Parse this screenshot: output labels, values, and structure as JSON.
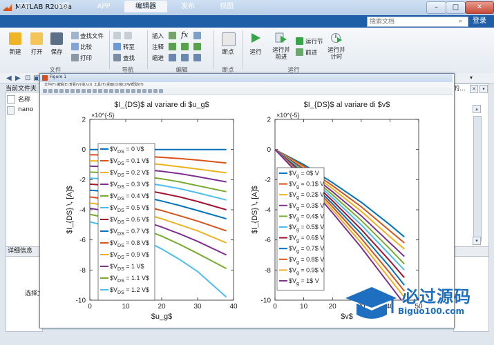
{
  "window": {
    "title": "MATLAB R2018a"
  },
  "tabs": [
    {
      "label": "主页",
      "active": false
    },
    {
      "label": "绘图",
      "active": false
    },
    {
      "label": "APP",
      "active": false
    },
    {
      "label": "编辑器",
      "active": true
    },
    {
      "label": "发布",
      "active": false
    },
    {
      "label": "视图",
      "active": false
    }
  ],
  "search": {
    "placeholder": "搜索文档"
  },
  "login_label": "登录",
  "ribbon": {
    "file": {
      "new": "新建",
      "open": "打开",
      "save": "保存",
      "find_files": "查找文件",
      "compare": "比较",
      "print": "打印",
      "group": "文件"
    },
    "navigate": {
      "goto": "转至",
      "find": "查找",
      "group": "导航"
    },
    "edit": {
      "insert": "插入",
      "comment": "注释",
      "indent": "缩进",
      "group": "编辑"
    },
    "breakpoints": {
      "bp": "断点",
      "group": "断点"
    },
    "run": {
      "run": "运行",
      "run_advance": "运行并\n前进",
      "run_section": "运行节",
      "advance": "前进",
      "run_time": "运行并\n计时",
      "group": "运行"
    }
  },
  "left_panel": {
    "header": "当前文件夹",
    "name_col": "名称",
    "file": "nano",
    "detail_header": "详细信息",
    "select_hint": "选择文"
  },
  "right_panel": {
    "header": "的..."
  },
  "figure": {
    "title": "Figure 1",
    "menu": [
      "文件(F)",
      "编辑(E)",
      "查看(V)",
      "插入(I)",
      "工具(T)",
      "桌面(D)",
      "窗口(W)",
      "帮助(H)"
    ]
  },
  "watermark": {
    "text": "必过源码",
    "url": "Biguo100.com"
  },
  "colors": {
    "series": [
      "#0072BD",
      "#D95319",
      "#EDB120",
      "#7E2F8E",
      "#77AC30",
      "#4DBEEE",
      "#A2142F"
    ]
  },
  "chart_data": [
    {
      "type": "line",
      "title": "$I_{DS}$ al variare di $u_g$",
      "xlabel": "$u_g$",
      "ylabel": "$I_{DS} \\, [A]$",
      "exponent_label": "×10^{-5}",
      "xlim": [
        0,
        40
      ],
      "ylim": [
        -10,
        2
      ],
      "xticks": [
        0,
        10,
        20,
        30,
        40
      ],
      "yticks": [
        2,
        0,
        -2,
        -4,
        -6,
        -8,
        -10
      ],
      "grid": false,
      "legend_position": "left-center",
      "legend_subscript": "DS",
      "series": [
        {
          "name": "$V_{DS} = 0 V$",
          "x": [
            0,
            5,
            10,
            15,
            20,
            25,
            30,
            38
          ],
          "y": [
            0,
            0,
            0,
            0,
            0,
            0,
            0,
            0
          ]
        },
        {
          "name": "$V_{DS} = 0.1 V$",
          "x": [
            0,
            5,
            10,
            15,
            20,
            25,
            30,
            38
          ],
          "y": [
            -0.35,
            -0.37,
            -0.4,
            -0.45,
            -0.52,
            -0.6,
            -0.7,
            -0.9
          ]
        },
        {
          "name": "$V_{DS} = 0.2 V$",
          "x": [
            0,
            5,
            10,
            15,
            20,
            25,
            30,
            38
          ],
          "y": [
            -0.75,
            -0.78,
            -0.83,
            -0.9,
            -1.0,
            -1.15,
            -1.3,
            -1.55
          ]
        },
        {
          "name": "$V_{DS} = 0.3 V$",
          "x": [
            0,
            5,
            10,
            15,
            20,
            25,
            30,
            38
          ],
          "y": [
            -1.1,
            -1.15,
            -1.22,
            -1.32,
            -1.45,
            -1.6,
            -1.8,
            -2.15
          ]
        },
        {
          "name": "$V_{DS} = 0.4 V$",
          "x": [
            0,
            5,
            10,
            15,
            20,
            25,
            30,
            38
          ],
          "y": [
            -1.5,
            -1.55,
            -1.65,
            -1.78,
            -1.95,
            -2.15,
            -2.4,
            -2.8
          ]
        },
        {
          "name": "$V_{DS} = 0.5 V$",
          "x": [
            0,
            5,
            10,
            15,
            20,
            25,
            30,
            38
          ],
          "y": [
            -1.9,
            -1.96,
            -2.06,
            -2.2,
            -2.38,
            -2.6,
            -2.88,
            -3.35
          ]
        },
        {
          "name": "$V_{DS} = 0.6 V$",
          "x": [
            0,
            5,
            10,
            15,
            20,
            25,
            30,
            38
          ],
          "y": [
            -2.3,
            -2.38,
            -2.5,
            -2.68,
            -2.9,
            -3.15,
            -3.45,
            -4.0
          ]
        },
        {
          "name": "$V_{DS} = 0.7 V$",
          "x": [
            0,
            5,
            10,
            15,
            20,
            25,
            30,
            38
          ],
          "y": [
            -2.7,
            -2.8,
            -2.95,
            -3.15,
            -3.42,
            -3.72,
            -4.05,
            -4.6
          ]
        },
        {
          "name": "$V_{DS} = 0.8 V$",
          "x": [
            0,
            5,
            10,
            15,
            20,
            25,
            30,
            38
          ],
          "y": [
            -3.15,
            -3.3,
            -3.5,
            -3.75,
            -4.05,
            -4.4,
            -4.75,
            -5.4
          ]
        },
        {
          "name": "$V_{DS} = 0.9 V$",
          "x": [
            0,
            5,
            10,
            15,
            20,
            25,
            30,
            38
          ],
          "y": [
            -3.55,
            -3.72,
            -3.95,
            -4.25,
            -4.6,
            -5.0,
            -5.4,
            -6.2
          ]
        },
        {
          "name": "$V_{DS} = 1 V$",
          "x": [
            0,
            5,
            10,
            15,
            20,
            25,
            30,
            38
          ],
          "y": [
            -3.9,
            -4.1,
            -4.4,
            -4.75,
            -5.15,
            -5.6,
            -6.1,
            -7.0
          ]
        },
        {
          "name": "$V_{DS} = 1.1 V$",
          "x": [
            0,
            5,
            10,
            15,
            20,
            25,
            30,
            38
          ],
          "y": [
            -4.3,
            -4.55,
            -4.88,
            -5.3,
            -5.75,
            -6.3,
            -6.9,
            -7.9
          ]
        },
        {
          "name": "$V_{DS} = 1.2 V$",
          "x": [
            0,
            5,
            10,
            15,
            20,
            25,
            30,
            38
          ],
          "y": [
            -4.8,
            -5.1,
            -5.5,
            -6.0,
            -6.6,
            -7.3,
            -8.1,
            -9.8
          ]
        }
      ]
    },
    {
      "type": "line",
      "title": "$I_{DS}$ al variare di $v$",
      "xlabel": "$v$",
      "ylabel": "$I_{DS} \\, [A]$",
      "exponent_label": "×10^{-5}",
      "xlim": [
        0,
        50
      ],
      "ylim": [
        -10,
        2
      ],
      "xticks": [
        0,
        10,
        20,
        30,
        40,
        50
      ],
      "yticks": [
        2,
        0,
        -2,
        -4,
        -6,
        -8,
        -10
      ],
      "grid": false,
      "legend_position": "left-center",
      "legend_subscript": "g",
      "series": [
        {
          "name": "$V_g = 0$ V",
          "x": [
            0,
            5,
            10,
            20,
            30,
            40,
            45
          ],
          "y": [
            0,
            -0.5,
            -1.0,
            -2.2,
            -3.5,
            -5.0,
            -5.8
          ]
        },
        {
          "name": "$V_g = 0.1$ V",
          "x": [
            0,
            5,
            10,
            20,
            30,
            40,
            45
          ],
          "y": [
            0,
            -0.55,
            -1.1,
            -2.4,
            -3.8,
            -5.4,
            -6.2
          ]
        },
        {
          "name": "$V_g = 0.2$ V",
          "x": [
            0,
            5,
            10,
            20,
            30,
            40,
            45
          ],
          "y": [
            0,
            -0.6,
            -1.2,
            -2.6,
            -4.1,
            -5.8,
            -6.6
          ]
        },
        {
          "name": "$V_g = 0.3$ V",
          "x": [
            0,
            5,
            10,
            20,
            30,
            40,
            45
          ],
          "y": [
            0,
            -0.65,
            -1.3,
            -2.8,
            -4.4,
            -6.2,
            -7.1
          ]
        },
        {
          "name": "$V_g = 0.4$ V",
          "x": [
            0,
            5,
            10,
            20,
            30,
            40,
            45
          ],
          "y": [
            0,
            -0.7,
            -1.4,
            -3.0,
            -4.7,
            -6.6,
            -7.6
          ]
        },
        {
          "name": "$V_g = 0.5$ V",
          "x": [
            0,
            5,
            10,
            20,
            30,
            40,
            45
          ],
          "y": [
            0,
            -0.75,
            -1.5,
            -3.2,
            -5.0,
            -7.0,
            -8.0
          ]
        },
        {
          "name": "$V_g = 0.6$ V",
          "x": [
            0,
            5,
            10,
            20,
            30,
            40,
            45
          ],
          "y": [
            0,
            -0.8,
            -1.6,
            -3.4,
            -5.3,
            -7.4,
            -8.5
          ]
        },
        {
          "name": "$V_g = 0.7$ V",
          "x": [
            0,
            5,
            10,
            20,
            30,
            40,
            45
          ],
          "y": [
            0,
            -0.85,
            -1.7,
            -3.6,
            -5.6,
            -7.8,
            -9.0
          ]
        },
        {
          "name": "$V_g = 0.8$ V",
          "x": [
            0,
            5,
            10,
            20,
            30,
            40,
            45
          ],
          "y": [
            0,
            -0.9,
            -1.8,
            -3.8,
            -5.9,
            -8.2,
            -9.4
          ]
        },
        {
          "name": "$V_g = 0.9$ V",
          "x": [
            0,
            5,
            10,
            20,
            30,
            40,
            45
          ],
          "y": [
            0,
            -0.95,
            -1.9,
            -4.0,
            -6.2,
            -8.6,
            -9.8
          ]
        },
        {
          "name": "$V_g = 1$ V",
          "x": [
            0,
            5,
            10,
            20,
            30,
            40,
            44
          ],
          "y": [
            0,
            -1.0,
            -2.0,
            -4.2,
            -6.5,
            -9.0,
            -10.0
          ]
        }
      ]
    }
  ]
}
